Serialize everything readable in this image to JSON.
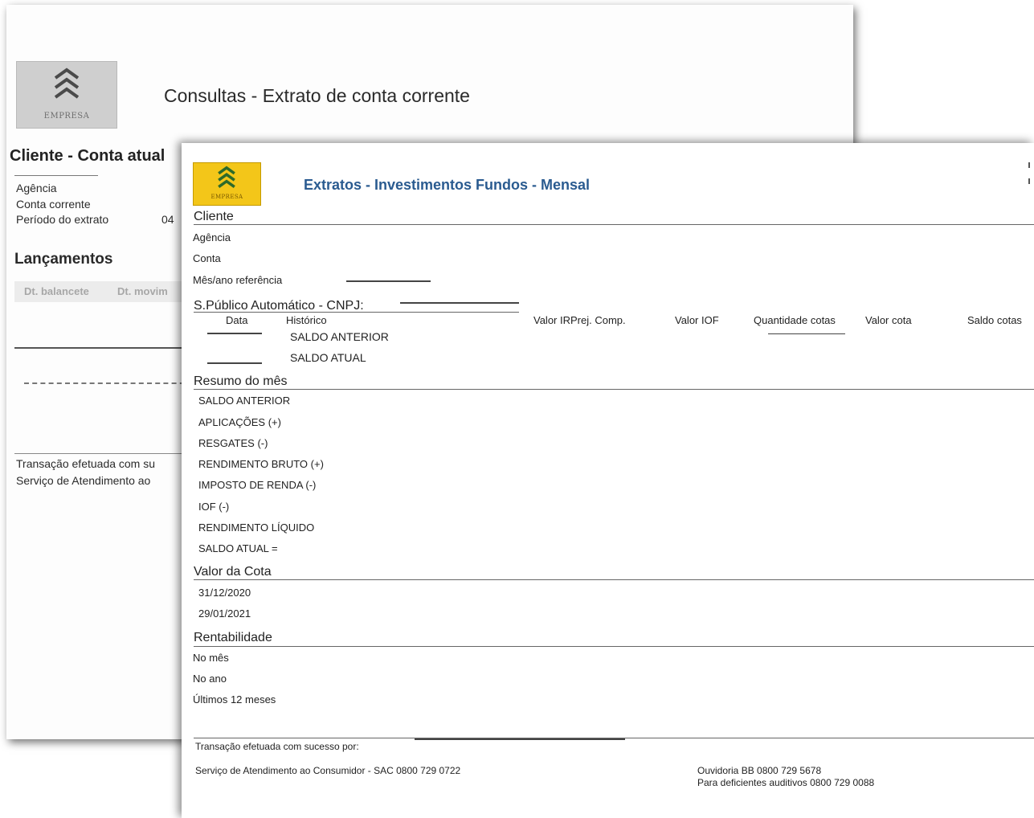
{
  "back_document": {
    "logo_text": "EMPRESA",
    "title": "Consultas - Extrato de conta corrente",
    "cliente_heading": "Cliente - Conta atual",
    "labels": {
      "agencia": "Agência",
      "conta_corrente": "Conta corrente",
      "periodo": "Período do extrato"
    },
    "periodo_value": "04",
    "lancamentos_heading": "Lançamentos",
    "table_headers": [
      "Dt. balancete",
      "Dt. movim"
    ],
    "footer": {
      "transacao": "Transação efetuada com su",
      "servico": "Serviço de Atendimento ao"
    }
  },
  "front_document": {
    "logo_text": "EMPRESA",
    "title": "Extratos - Investimentos Fundos - Mensal",
    "cliente_heading": "Cliente",
    "labels": {
      "agencia": "Agência",
      "conta": "Conta",
      "mes_ano": "Mês/ano referência"
    },
    "fund_heading": "S.Público Automático - CNPJ:",
    "columns": [
      "Data",
      "Histórico",
      "Valor IRPrej. Comp.",
      "Valor IOF",
      "Quantidade cotas",
      "Valor cota",
      "Saldo cotas"
    ],
    "rows": [
      "SALDO ANTERIOR",
      "SALDO ATUAL"
    ],
    "resumo_heading": "Resumo do mês",
    "resumo_items": [
      "SALDO ANTERIOR",
      "APLICAÇÕES (+)",
      "RESGATES (-)",
      "RENDIMENTO BRUTO (+)",
      "IMPOSTO DE RENDA (-)",
      "IOF (-)",
      "RENDIMENTO LÍQUIDO",
      "SALDO ATUAL ="
    ],
    "valor_cota_heading": "Valor da Cota",
    "valor_cota_dates": [
      "31/12/2020",
      "29/01/2021"
    ],
    "rentabilidade_heading": "Rentabilidade",
    "rentabilidade_items": [
      "No mês",
      "No ano",
      "Últimos 12 meses"
    ],
    "footer": {
      "transacao": "Transação efetuada com sucesso por:",
      "sac": "Serviço de Atendimento ao Consumidor - SAC 0800 729 0722",
      "ouvidoria": "Ouvidoria BB 0800 729 5678",
      "deficientes": "Para deficientes auditivos 0800 729 0088"
    }
  },
  "colors": {
    "front_title": "#2a5b90",
    "front_logo": "#f3c619",
    "back_logo": "#cfcfcf"
  }
}
